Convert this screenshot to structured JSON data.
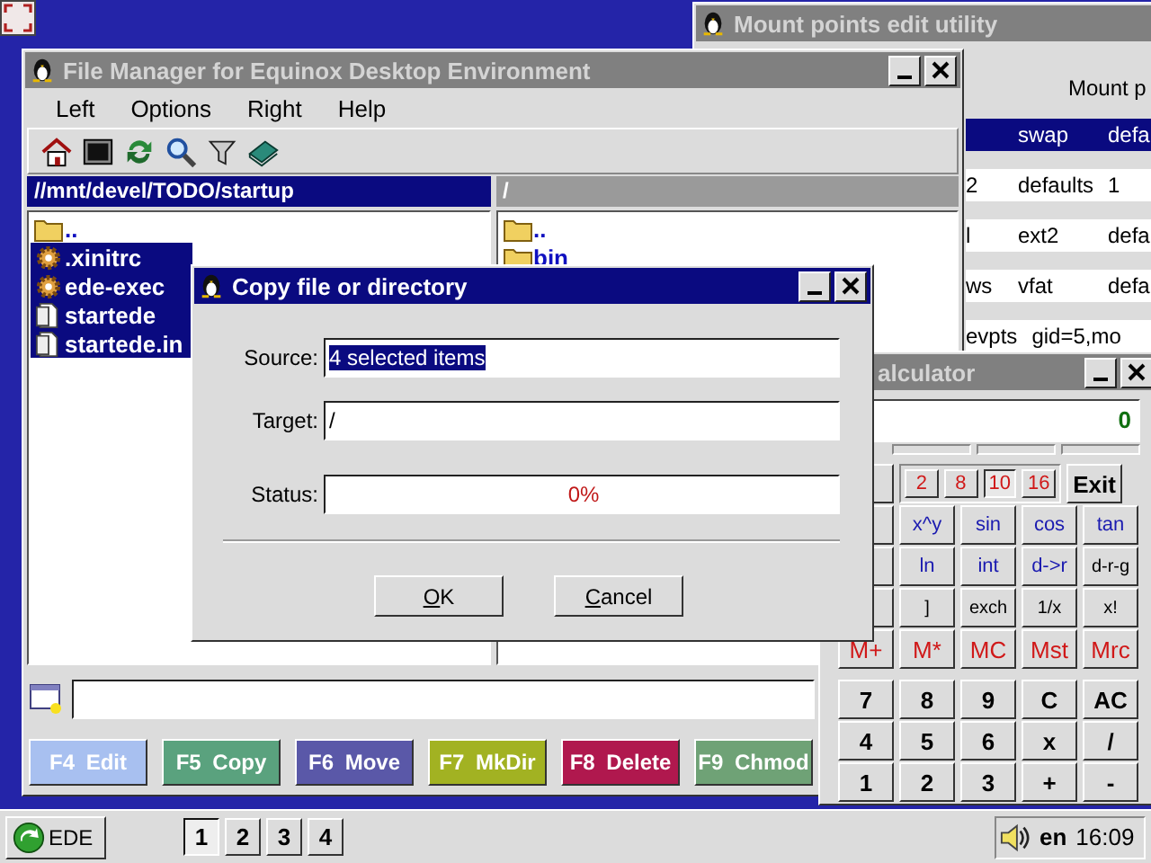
{
  "mount_window": {
    "title": "Mount points edit utility",
    "header": "Mount p",
    "rows": [
      {
        "selected": true,
        "column_2": "swap",
        "column_3": "defa"
      },
      {
        "selected": false,
        "column_1": "2",
        "column_2": "defaults",
        "column_3": "1"
      },
      {
        "selected": false,
        "column_1": "l",
        "column_2": "ext2",
        "column_3": "defa"
      },
      {
        "selected": false,
        "column_1": "ws",
        "column_2": "vfat",
        "column_3": "defa"
      },
      {
        "selected": false,
        "column_1": "evpts",
        "column_2": "gid=5,mo"
      }
    ]
  },
  "file_manager": {
    "title": "File Manager for Equinox Desktop Environment",
    "menu": [
      "Left",
      "Options",
      "Right",
      "Help"
    ],
    "left_pane": {
      "path": "//mnt/devel/TODO/startup",
      "active": true,
      "items": [
        {
          "name": "..",
          "kind": "folder",
          "selected": false
        },
        {
          "name": ".xinitrc",
          "kind": "executable",
          "selected": true
        },
        {
          "name": "ede-exec",
          "kind": "executable",
          "selected": true
        },
        {
          "name": "startede",
          "kind": "file",
          "selected": true
        },
        {
          "name": "startede.in",
          "kind": "file",
          "selected": true
        }
      ]
    },
    "right_pane": {
      "path": "/",
      "active": false,
      "items": [
        {
          "name": "..",
          "kind": "folder",
          "selected": false
        },
        {
          "name": "bin",
          "kind": "folder",
          "selected": false
        }
      ]
    },
    "function_keys": [
      {
        "label": "F4 Edit",
        "color": "#a8c0f0"
      },
      {
        "label": "F5 Copy",
        "color": "#5aa27e"
      },
      {
        "label": "F6 Move",
        "color": "#5a58a8"
      },
      {
        "label": "F7 MkDir",
        "color": "#a2b222"
      },
      {
        "label": "F8 Delete",
        "color": "#b0184e"
      },
      {
        "label": "F9 Chmod",
        "color": "#6fa276"
      }
    ]
  },
  "calculator": {
    "title": "alculator",
    "display": "0",
    "bases": [
      {
        "label": "2",
        "selected": false
      },
      {
        "label": "8",
        "selected": false
      },
      {
        "label": "10",
        "selected": true
      },
      {
        "label": "16",
        "selected": false
      }
    ],
    "exit": "Exit",
    "key_rows": [
      [
        {
          "label": "x^y",
          "kind": "function"
        },
        {
          "label": "sin",
          "kind": "function"
        },
        {
          "label": "cos",
          "kind": "function"
        },
        {
          "label": "tan",
          "kind": "function"
        }
      ],
      [
        {
          "label": "ln",
          "kind": "function"
        },
        {
          "label": "int",
          "kind": "function"
        },
        {
          "label": "d->r",
          "kind": "function"
        },
        {
          "label": "d-r-g",
          "kind": "plain"
        }
      ],
      [
        {
          "label": "]",
          "kind": "plain"
        },
        {
          "label": "exch",
          "kind": "plain"
        },
        {
          "label": "1/x",
          "kind": "plain"
        },
        {
          "label": "x!",
          "kind": "plain"
        }
      ],
      [
        {
          "label": "M+",
          "kind": "memory"
        },
        {
          "label": "M*",
          "kind": "memory"
        },
        {
          "label": "MC",
          "kind": "memory"
        },
        {
          "label": "Mst",
          "kind": "memory"
        },
        {
          "label": "Mrc",
          "kind": "memory"
        }
      ],
      [
        {
          "label": "7",
          "kind": "digit"
        },
        {
          "label": "8",
          "kind": "digit"
        },
        {
          "label": "9",
          "kind": "digit"
        },
        {
          "label": "C",
          "kind": "digit"
        },
        {
          "label": "AC",
          "kind": "digit"
        }
      ],
      [
        {
          "label": "4",
          "kind": "digit"
        },
        {
          "label": "5",
          "kind": "digit"
        },
        {
          "label": "6",
          "kind": "digit"
        },
        {
          "label": "x",
          "kind": "digit"
        },
        {
          "label": "/",
          "kind": "digit"
        }
      ],
      [
        {
          "label": "1",
          "kind": "digit"
        },
        {
          "label": "2",
          "kind": "digit"
        },
        {
          "label": "3",
          "kind": "digit"
        },
        {
          "label": "+",
          "kind": "digit"
        },
        {
          "label": "-",
          "kind": "digit"
        }
      ]
    ]
  },
  "dialog": {
    "title": "Copy file or directory",
    "fields": [
      {
        "label": "Source:",
        "value": "4 selected items",
        "highlighted": true
      },
      {
        "label": "Target:",
        "value": "/",
        "highlighted": false
      }
    ],
    "status": {
      "label": "Status:",
      "reading": "0%",
      "level": 0
    },
    "buttons": [
      "OK",
      "Cancel"
    ]
  },
  "taskbar": {
    "start": "EDE",
    "workspaces": [
      {
        "label": "1",
        "selected": true
      },
      {
        "label": "2",
        "selected": false
      },
      {
        "label": "3",
        "selected": false
      },
      {
        "label": "4",
        "selected": false
      }
    ],
    "language": "en",
    "clock": "16:09"
  }
}
